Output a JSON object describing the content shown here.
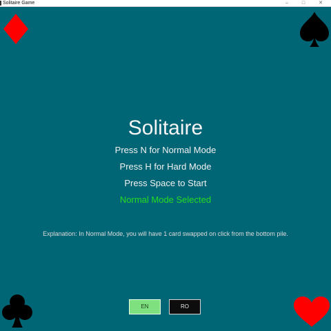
{
  "window": {
    "title": "Solitaire Game",
    "controls": {
      "minimize": "–",
      "maximize": "□",
      "close": "✕"
    }
  },
  "corners": {
    "top_left": {
      "icon": "diamond-icon",
      "color": "#ff0000"
    },
    "top_right": {
      "icon": "spade-icon",
      "color": "#000000"
    },
    "bottom_left": {
      "icon": "club-icon",
      "color": "#000000"
    },
    "bottom_right": {
      "icon": "heart-icon",
      "color": "#ff0000"
    }
  },
  "menu": {
    "title": "Solitaire",
    "normal_mode_hint": "Press N for Normal Mode",
    "hard_mode_hint": "Press H for Hard Mode",
    "start_hint": "Press Space to Start",
    "mode_status": "Normal Mode Selected",
    "explanation": "Explanation: In Normal Mode, you will have 1 card swapped on click from the bottom pile."
  },
  "language": {
    "en_label": "EN",
    "ro_label": "RO",
    "selected": "EN"
  },
  "colors": {
    "background": "#006574",
    "mode_status": "#22dd22",
    "en_button": "#7fe07f",
    "ro_button": "#0d0d0d"
  }
}
